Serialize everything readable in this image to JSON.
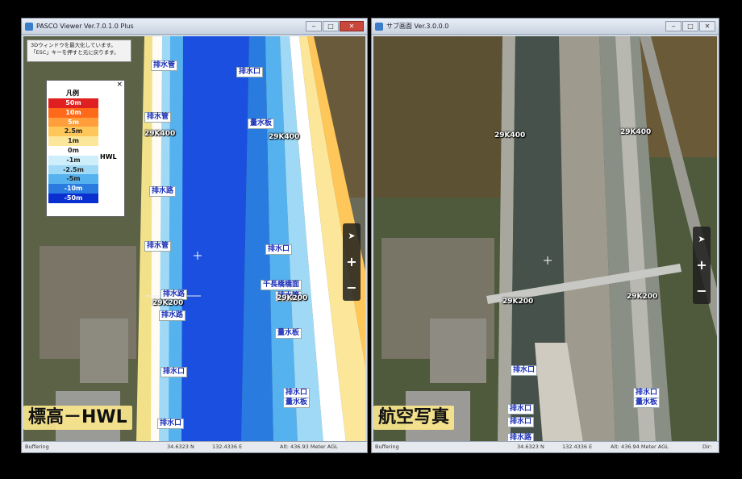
{
  "left_window": {
    "title": "PASCO Viewer Ver.7.0.1.0 Plus",
    "buttons": {
      "minimize": "‒",
      "maximize": "□",
      "close": "✕"
    },
    "hint": "3Dウィンドウを最大化しています。「ESC」キーを押すと元に戻ります。",
    "legend": {
      "title": "凡例",
      "close": "×",
      "hwl": "HWL",
      "rows": [
        {
          "label": "50m",
          "color": "#e02020",
          "text": "#ffffff"
        },
        {
          "label": "10m",
          "color": "#ff6a1a",
          "text": "#ffffff"
        },
        {
          "label": "5m",
          "color": "#ff9e3a",
          "text": "#ffffff"
        },
        {
          "label": "2.5m",
          "color": "#ffc65a",
          "text": "#222222"
        },
        {
          "label": "1m",
          "color": "#fbe69a",
          "text": "#222222"
        },
        {
          "label": "0m",
          "color": "#ffffff",
          "text": "#222222"
        },
        {
          "label": "-1m",
          "color": "#cfeefb",
          "text": "#222222"
        },
        {
          "label": "-2.5m",
          "color": "#9fd9f6",
          "text": "#222222"
        },
        {
          "label": "-5m",
          "color": "#55b2ee",
          "text": "#222222"
        },
        {
          "label": "-10m",
          "color": "#2a7be0",
          "text": "#ffffff"
        },
        {
          "label": "-50m",
          "color": "#0a2fd0",
          "text": "#ffffff"
        }
      ]
    },
    "map_labels": {
      "l1": "排水管",
      "l2": "排水口",
      "l3": "排水管",
      "l4": "量水板",
      "l5": "排水路",
      "l6": "排水管",
      "l7": "排水口",
      "l8": "千長橋橋面",
      "l9": "排水路",
      "l10": "排水路",
      "l11": "量水板",
      "l12": "排水口",
      "l13": "排水口",
      "l14": "量水板",
      "l15": "排水口",
      "l16": "排水管"
    },
    "k_labels": {
      "k1": "29K400",
      "k2": "29K400",
      "k3": "29K200",
      "k4": "29K200"
    },
    "caption": "標高－HWL",
    "status": {
      "lat": "34.6323 N",
      "lon": "132.4336 E",
      "alt": "Alt: 436.93 Meter AGL",
      "mode": "Buffering"
    },
    "nav": {
      "compass": "➤",
      "zoom_in": "+",
      "zoom_out": "−"
    }
  },
  "right_window": {
    "title": "サブ画面 Ver.3.0.0.0",
    "buttons": {
      "minimize": "‒",
      "maximize": "□",
      "close": "✕"
    },
    "map_labels": {
      "r1": "排水口",
      "r2": "排水口",
      "r3": "排水口",
      "r4": "量水板",
      "r5": "排水口",
      "r6": "排水路"
    },
    "k_labels": {
      "k1": "29K400",
      "k2": "29K400",
      "k3": "29K200",
      "k4": "29K200"
    },
    "caption": "航空写真",
    "status": {
      "lat": "34.6323 N",
      "lon": "132.4336 E",
      "alt": "Alt: 436.94 Meter AGL",
      "mode": "Buffering",
      "dir": "Dir:"
    },
    "nav": {
      "compass": "➤",
      "zoom_in": "+",
      "zoom_out": "−"
    }
  }
}
